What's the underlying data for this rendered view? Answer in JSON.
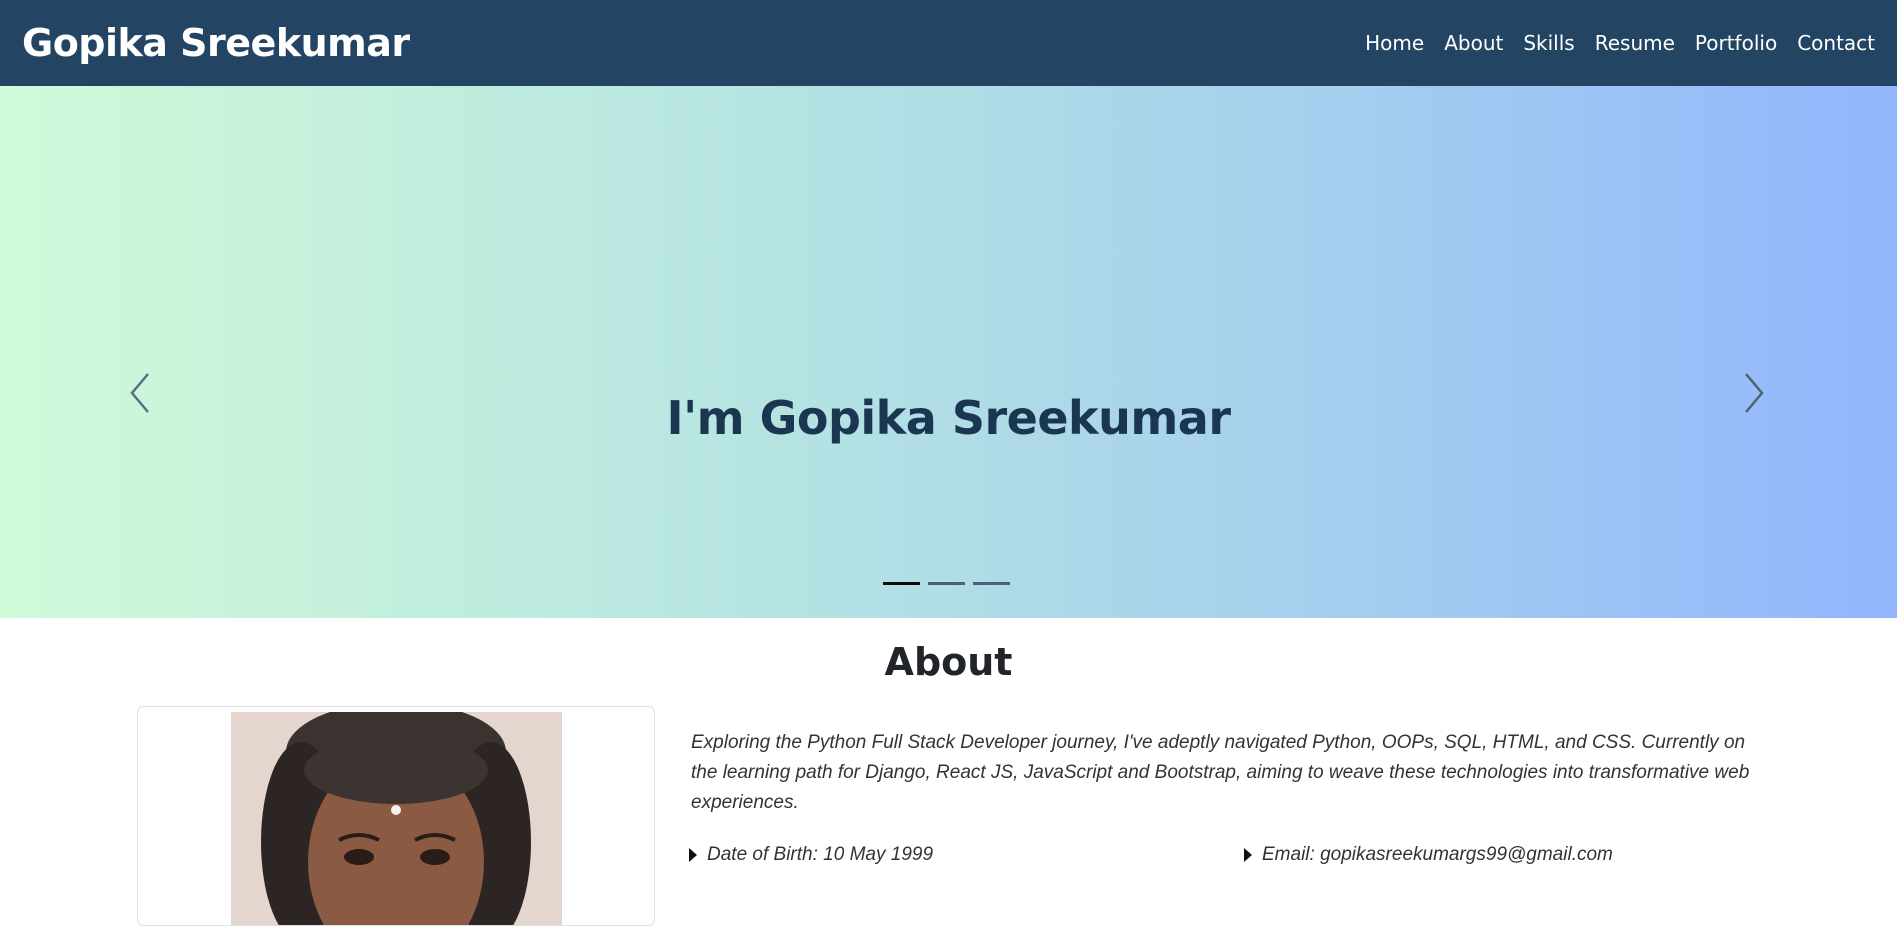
{
  "navbar": {
    "brand": "Gopika Sreekumar",
    "links": [
      "Home",
      "About",
      "Skills",
      "Resume",
      "Portfolio",
      "Contact"
    ]
  },
  "hero": {
    "title": "I'm Gopika Sreekumar",
    "slide_count": 3,
    "active_slide": 1,
    "prev_icon": "chevron-left-icon",
    "next_icon": "chevron-right-icon"
  },
  "about": {
    "heading": "About",
    "bio": "Exploring the Python Full Stack Developer journey, I've adeptly navigated Python, OOPs, SQL, HTML, and CSS. Currently on the learning path for Django, React JS, JavaScript and Bootstrap, aiming to weave these technologies into transformative web experiences.",
    "details": {
      "dob": "Date of Birth: 10 May 1999",
      "email": "Email: gopikasreekumargs99@gmail.com"
    }
  },
  "colors": {
    "navbar_bg": "#234563",
    "hero_gradient_start": "#d0fad8",
    "hero_gradient_end": "#92b5fd",
    "hero_title": "#1b3650"
  }
}
